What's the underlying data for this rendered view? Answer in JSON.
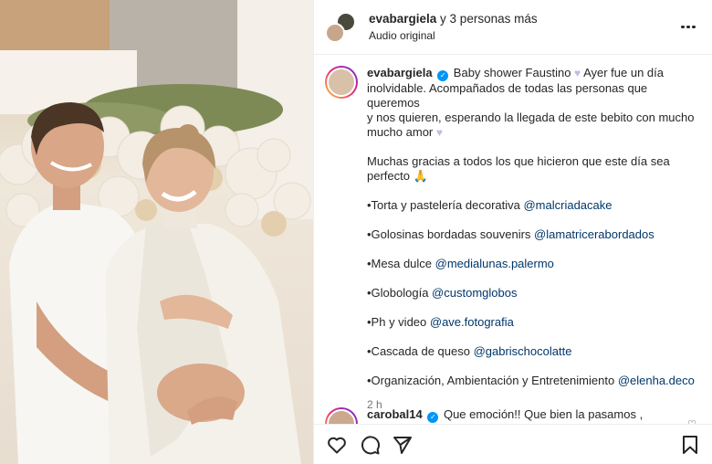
{
  "header": {
    "username": "evabargiela",
    "collab_text": " y 3 personas más",
    "audio": "Audio original"
  },
  "caption": {
    "username": "evabargiela",
    "line1": "Baby shower Faustino",
    "line1b": " Ayer fue un día",
    "line2": "inolvidable. Acompañados de todas las personas que queremos",
    "line3": "y nos quieren, esperando la llegada de este bebito con mucho",
    "line4": "mucho amor",
    "thanks1": "Muchas gracias a todos los que hicieron que este día sea",
    "thanks2": "perfecto",
    "credits": [
      {
        "text": "•Torta y pastelería decorativa ",
        "mention": "@malcriadacake"
      },
      {
        "text": "•Golosinas bordadas souvenirs ",
        "mention": "@lamatricerabordados"
      },
      {
        "text": "•Mesa dulce ",
        "mention": "@medialunas.palermo"
      },
      {
        "text": "•Globología ",
        "mention": "@customglobos"
      },
      {
        "text": "•Ph y video ",
        "mention": "@ave.fotografia"
      },
      {
        "text": "•Cascada de queso ",
        "mention": "@gabrischocolatte"
      },
      {
        "text": "•Organización, Ambientación y Entretenimiento ",
        "mention": "@elenha.deco"
      }
    ],
    "time": "2 h"
  },
  "comment": {
    "username": "carobal14",
    "text": "Que emoción!! Que bien la pasamos , que lindos"
  },
  "icons": {
    "more": "more-horizontal-icon",
    "like": "heart-icon",
    "comment": "comment-icon",
    "share": "send-icon",
    "save": "bookmark-icon"
  },
  "colors": {
    "mention": "#00376b",
    "verified": "#0095f6",
    "muted": "#737373"
  }
}
